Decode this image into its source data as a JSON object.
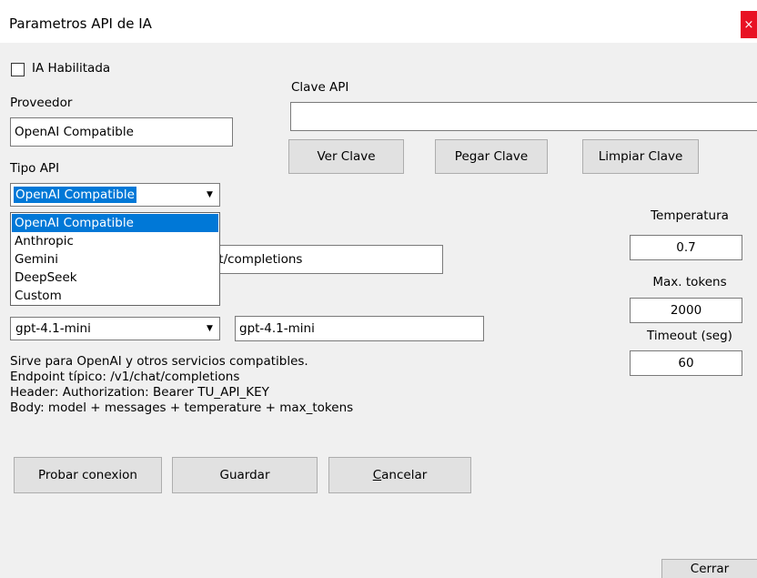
{
  "window": {
    "title": "Parametros API de IA",
    "close_glyph": "×"
  },
  "ia_enabled": {
    "label": "IA Habilitada",
    "checked": false
  },
  "provider": {
    "label": "Proveedor",
    "value": "OpenAI Compatible"
  },
  "api_key": {
    "label": "Clave API",
    "value": ""
  },
  "buttons": {
    "show_key": "Ver Clave",
    "paste_key": "Pegar Clave",
    "clear_key": "Limpiar Clave",
    "test_connection": "Probar conexion",
    "save": "Guardar",
    "cancel_prefix": "C",
    "cancel_rest": "ancelar",
    "close": "Cerrar"
  },
  "api_type": {
    "label": "Tipo API",
    "selected": "OpenAI Compatible",
    "options": [
      "OpenAI Compatible",
      "Anthropic",
      "Gemini",
      "DeepSeek",
      "Custom"
    ]
  },
  "endpoint": {
    "visible_value": "at/completions"
  },
  "model": {
    "selected": "gpt-4.1-mini",
    "value": "gpt-4.1-mini"
  },
  "info_lines": [
    "Sirve para OpenAI y otros servicios compatibles.",
    "Endpoint típico: /v1/chat/completions",
    "Header: Authorization: Bearer TU_API_KEY",
    "Body: model + messages + temperature + max_tokens"
  ],
  "temperature": {
    "label": "Temperatura",
    "value": "0.7"
  },
  "max_tokens": {
    "label": "Max. tokens",
    "value": "2000"
  },
  "timeout": {
    "label": "Timeout (seg)",
    "value": "60"
  },
  "icons": {
    "checkbox": "checkbox-icon",
    "combo_arrow": "chevron-down-icon",
    "close": "close-icon"
  }
}
